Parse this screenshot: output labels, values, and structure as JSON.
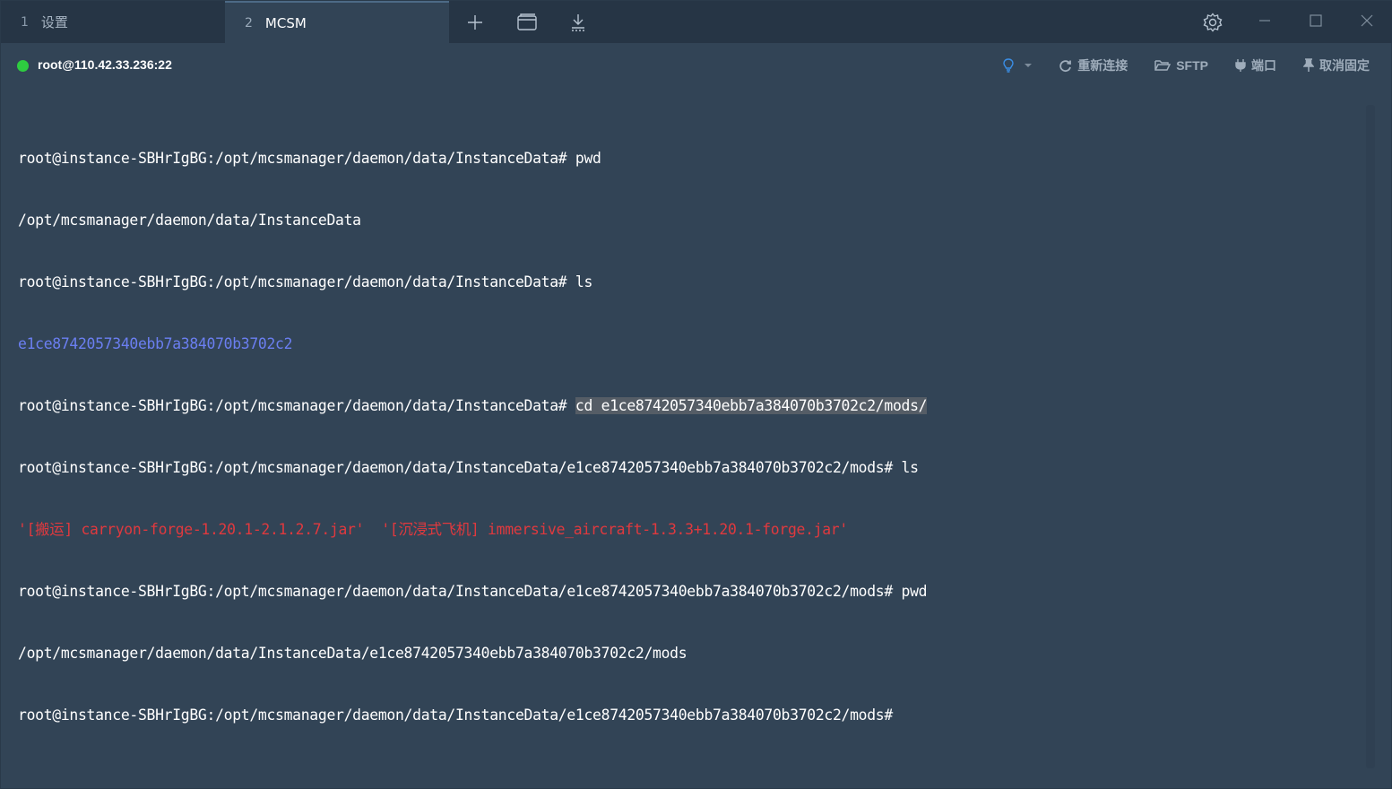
{
  "tabs": [
    {
      "num": "1",
      "label": "设置"
    },
    {
      "num": "2",
      "label": "MCSM"
    }
  ],
  "toolbar": {
    "icons": [
      "plus-icon",
      "window-icon",
      "download-icon",
      "gear-icon"
    ]
  },
  "window_controls": [
    "minimize",
    "maximize",
    "close"
  ],
  "session": {
    "host": "root@110.42.33.236:22",
    "status_color": "#2ecc40"
  },
  "actions": {
    "reconnect": "重新连接",
    "sftp": "SFTP",
    "port": "端口",
    "unpin": "取消固定"
  },
  "terminal": {
    "lines": [
      {
        "type": "white",
        "text": "root@instance-SBHrIgBG:/opt/mcsmanager/daemon/data/InstanceData# pwd"
      },
      {
        "type": "white",
        "text": "/opt/mcsmanager/daemon/data/InstanceData"
      },
      {
        "type": "white",
        "text": "root@instance-SBHrIgBG:/opt/mcsmanager/daemon/data/InstanceData# ls"
      },
      {
        "type": "blue",
        "text": "e1ce8742057340ebb7a384070b3702c2"
      },
      {
        "type": "selected",
        "prefix": "root@instance-SBHrIgBG:/opt/mcsmanager/daemon/data/InstanceData# ",
        "selected": "cd e1ce8742057340ebb7a384070b3702c2/mods/"
      },
      {
        "type": "white",
        "text": "root@instance-SBHrIgBG:/opt/mcsmanager/daemon/data/InstanceData/e1ce8742057340ebb7a384070b3702c2/mods# ls"
      },
      {
        "type": "red",
        "text": "'[搬运] carryon-forge-1.20.1-2.1.2.7.jar'  '[沉浸式飞机] immersive_aircraft-1.3.3+1.20.1-forge.jar'"
      },
      {
        "type": "white",
        "text": "root@instance-SBHrIgBG:/opt/mcsmanager/daemon/data/InstanceData/e1ce8742057340ebb7a384070b3702c2/mods# pwd"
      },
      {
        "type": "white",
        "text": "/opt/mcsmanager/daemon/data/InstanceData/e1ce8742057340ebb7a384070b3702c2/mods"
      },
      {
        "type": "white",
        "text": "root@instance-SBHrIgBG:/opt/mcsmanager/daemon/data/InstanceData/e1ce8742057340ebb7a384070b3702c2/mods#"
      }
    ]
  }
}
